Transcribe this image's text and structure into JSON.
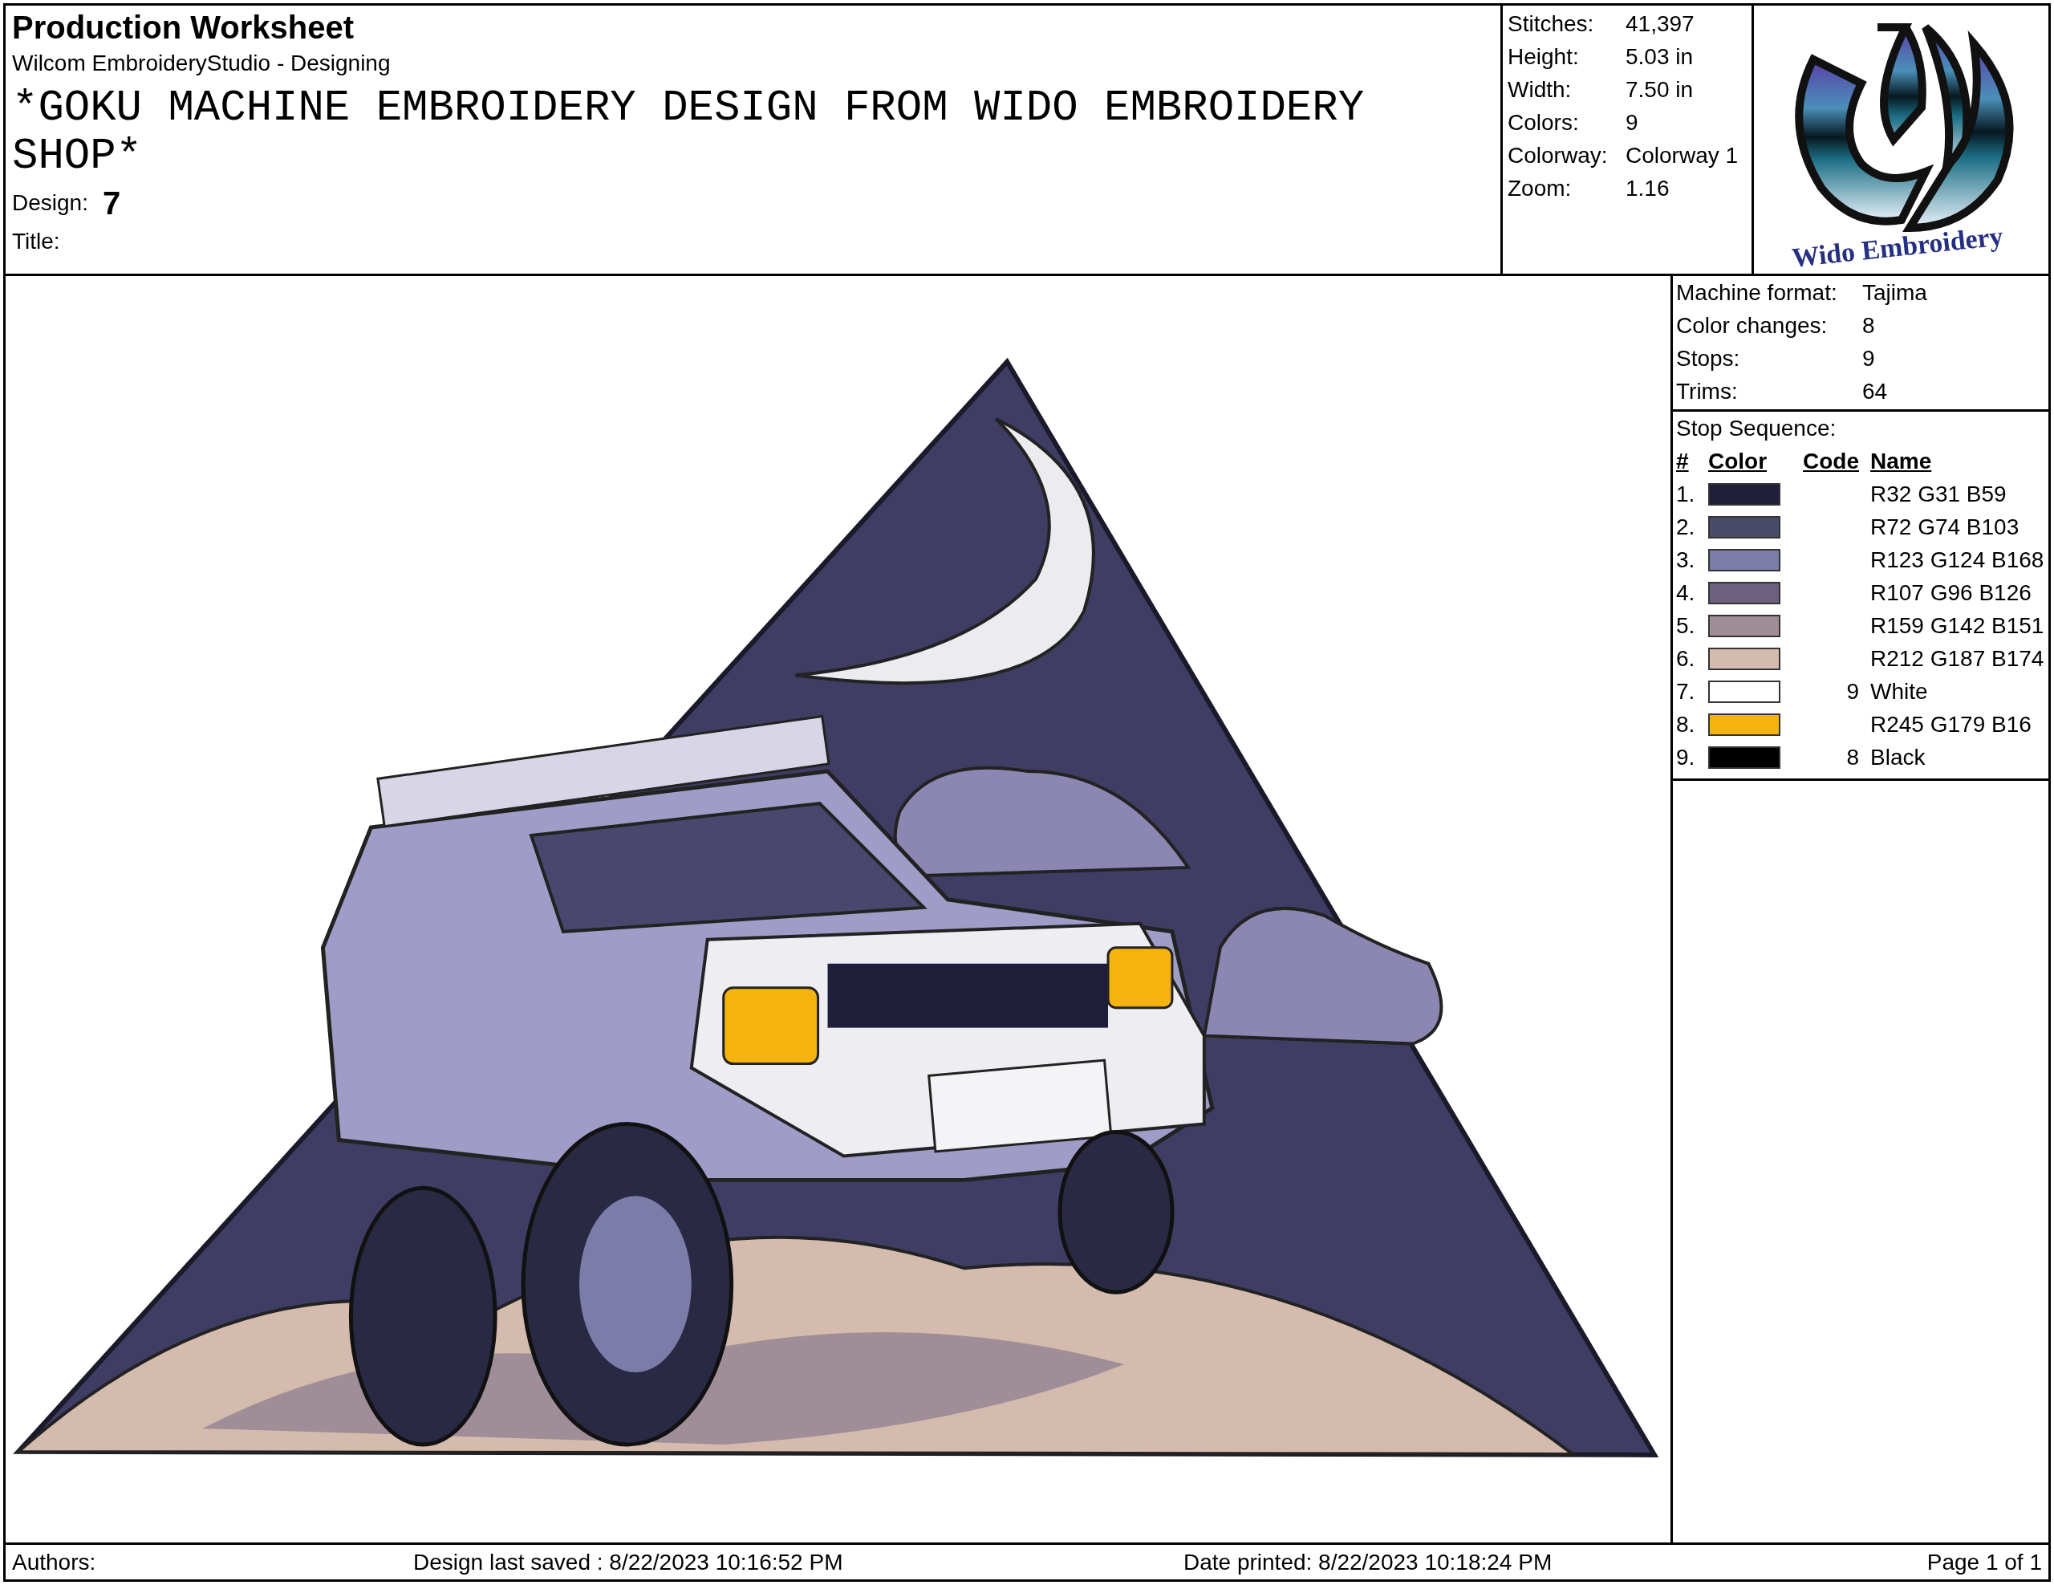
{
  "header": {
    "title": "Production Worksheet",
    "subtitle": "Wilcom EmbroideryStudio - Designing",
    "design_name": "*GOKU MACHINE EMBROIDERY DESIGN FROM WIDO EMBROIDERY SHOP*",
    "design_label": "Design:",
    "design_value": "7",
    "title_label": "Title:"
  },
  "stats": [
    {
      "label": "Stitches:",
      "value": "41,397"
    },
    {
      "label": "Height:",
      "value": "5.03 in"
    },
    {
      "label": "Width:",
      "value": "7.50 in"
    },
    {
      "label": "Colors:",
      "value": "9"
    },
    {
      "label": "Colorway:",
      "value": "Colorway 1"
    },
    {
      "label": "Zoom:",
      "value": "1.16"
    }
  ],
  "logo": {
    "text": "Wido Embroidery"
  },
  "machine_info": [
    {
      "label": "Machine format:",
      "value": "Tajima"
    },
    {
      "label": "Color changes:",
      "value": "8"
    },
    {
      "label": "Stops:",
      "value": "9"
    },
    {
      "label": "Trims:",
      "value": "64"
    }
  ],
  "stop_sequence": {
    "title": "Stop Sequence:",
    "columns": [
      "#",
      "Color",
      "Code",
      "Name"
    ],
    "rows": [
      {
        "number": "1.",
        "color": "#201f3b",
        "name": "R32 G31 B59"
      },
      {
        "number": "2.",
        "color": "#484a67",
        "name": "R72 G74 B103"
      },
      {
        "number": "3.",
        "color": "#7b7ca8",
        "name": "R123 G124 B168"
      },
      {
        "number": "4.",
        "color": "#6b607e",
        "name": "R107 G96 B126"
      },
      {
        "number": "5.",
        "color": "#9f8e97",
        "name": "R159 G142 B151"
      },
      {
        "number": "6.",
        "color": "#d4bbae",
        "name": "R212 G187 B174"
      },
      {
        "number": "7.",
        "color": "#ffffff",
        "code": "9",
        "name": "White"
      },
      {
        "number": "8.",
        "color": "#f5b310",
        "name": "R245 G179 B16"
      },
      {
        "number": "9.",
        "color": "#000000",
        "code": "8",
        "name": "Black"
      }
    ]
  },
  "footer": {
    "authors": "Authors:",
    "last_saved": "Design last saved : 8/22/2023 10:16:52 PM",
    "printed": "Date printed: 8/22/2023 10:18:24 PM",
    "page": "Page 1 of 1"
  }
}
